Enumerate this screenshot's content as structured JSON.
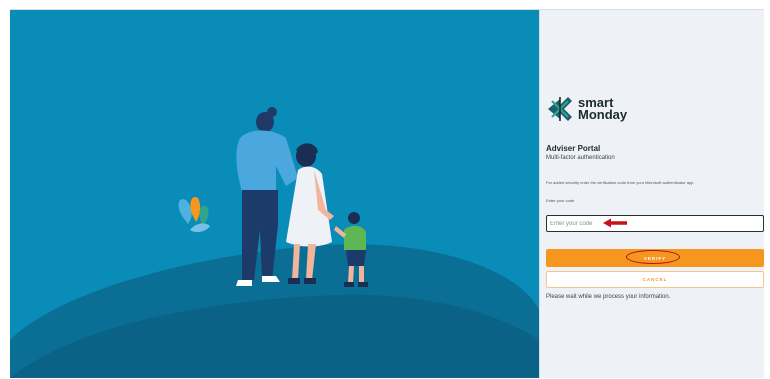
{
  "brand": {
    "logo_line1": "smart",
    "logo_line2": "Monday",
    "accent_color": "#f5961e",
    "hero_color": "#0a8cb8"
  },
  "login": {
    "title": "Adviser Portal",
    "subtitle": "Multi-factor authentication",
    "instructions": "For added security enter the verification code from your Microsoft authenticator app.",
    "code_label": "Enter your code",
    "code_placeholder": "Enter your code",
    "code_value": "",
    "verify_label": "VERIFY",
    "cancel_label": "CANCEL",
    "status_text": "Please wait while we process your information."
  },
  "icons": {
    "logo": "smart-monday-logo-icon",
    "annotation_arrow": "red-arrow-icon",
    "annotation_circle": "red-circle-highlight"
  }
}
